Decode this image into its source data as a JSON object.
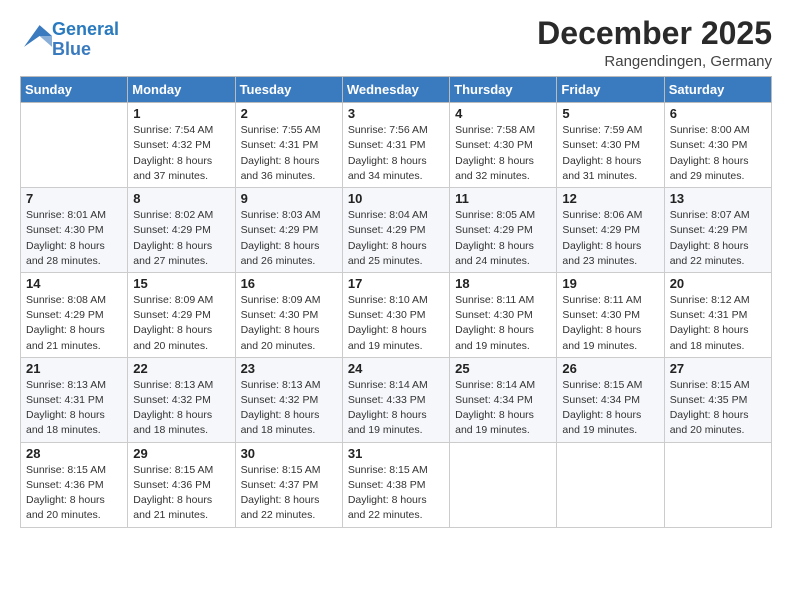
{
  "header": {
    "logo_line1": "General",
    "logo_line2": "Blue",
    "month": "December 2025",
    "location": "Rangendingen, Germany"
  },
  "weekdays": [
    "Sunday",
    "Monday",
    "Tuesday",
    "Wednesday",
    "Thursday",
    "Friday",
    "Saturday"
  ],
  "weeks": [
    [
      {
        "day": "",
        "info": ""
      },
      {
        "day": "1",
        "info": "Sunrise: 7:54 AM\nSunset: 4:32 PM\nDaylight: 8 hours\nand 37 minutes."
      },
      {
        "day": "2",
        "info": "Sunrise: 7:55 AM\nSunset: 4:31 PM\nDaylight: 8 hours\nand 36 minutes."
      },
      {
        "day": "3",
        "info": "Sunrise: 7:56 AM\nSunset: 4:31 PM\nDaylight: 8 hours\nand 34 minutes."
      },
      {
        "day": "4",
        "info": "Sunrise: 7:58 AM\nSunset: 4:30 PM\nDaylight: 8 hours\nand 32 minutes."
      },
      {
        "day": "5",
        "info": "Sunrise: 7:59 AM\nSunset: 4:30 PM\nDaylight: 8 hours\nand 31 minutes."
      },
      {
        "day": "6",
        "info": "Sunrise: 8:00 AM\nSunset: 4:30 PM\nDaylight: 8 hours\nand 29 minutes."
      }
    ],
    [
      {
        "day": "7",
        "info": "Sunrise: 8:01 AM\nSunset: 4:30 PM\nDaylight: 8 hours\nand 28 minutes."
      },
      {
        "day": "8",
        "info": "Sunrise: 8:02 AM\nSunset: 4:29 PM\nDaylight: 8 hours\nand 27 minutes."
      },
      {
        "day": "9",
        "info": "Sunrise: 8:03 AM\nSunset: 4:29 PM\nDaylight: 8 hours\nand 26 minutes."
      },
      {
        "day": "10",
        "info": "Sunrise: 8:04 AM\nSunset: 4:29 PM\nDaylight: 8 hours\nand 25 minutes."
      },
      {
        "day": "11",
        "info": "Sunrise: 8:05 AM\nSunset: 4:29 PM\nDaylight: 8 hours\nand 24 minutes."
      },
      {
        "day": "12",
        "info": "Sunrise: 8:06 AM\nSunset: 4:29 PM\nDaylight: 8 hours\nand 23 minutes."
      },
      {
        "day": "13",
        "info": "Sunrise: 8:07 AM\nSunset: 4:29 PM\nDaylight: 8 hours\nand 22 minutes."
      }
    ],
    [
      {
        "day": "14",
        "info": "Sunrise: 8:08 AM\nSunset: 4:29 PM\nDaylight: 8 hours\nand 21 minutes."
      },
      {
        "day": "15",
        "info": "Sunrise: 8:09 AM\nSunset: 4:29 PM\nDaylight: 8 hours\nand 20 minutes."
      },
      {
        "day": "16",
        "info": "Sunrise: 8:09 AM\nSunset: 4:30 PM\nDaylight: 8 hours\nand 20 minutes."
      },
      {
        "day": "17",
        "info": "Sunrise: 8:10 AM\nSunset: 4:30 PM\nDaylight: 8 hours\nand 19 minutes."
      },
      {
        "day": "18",
        "info": "Sunrise: 8:11 AM\nSunset: 4:30 PM\nDaylight: 8 hours\nand 19 minutes."
      },
      {
        "day": "19",
        "info": "Sunrise: 8:11 AM\nSunset: 4:30 PM\nDaylight: 8 hours\nand 19 minutes."
      },
      {
        "day": "20",
        "info": "Sunrise: 8:12 AM\nSunset: 4:31 PM\nDaylight: 8 hours\nand 18 minutes."
      }
    ],
    [
      {
        "day": "21",
        "info": "Sunrise: 8:13 AM\nSunset: 4:31 PM\nDaylight: 8 hours\nand 18 minutes."
      },
      {
        "day": "22",
        "info": "Sunrise: 8:13 AM\nSunset: 4:32 PM\nDaylight: 8 hours\nand 18 minutes."
      },
      {
        "day": "23",
        "info": "Sunrise: 8:13 AM\nSunset: 4:32 PM\nDaylight: 8 hours\nand 18 minutes."
      },
      {
        "day": "24",
        "info": "Sunrise: 8:14 AM\nSunset: 4:33 PM\nDaylight: 8 hours\nand 19 minutes."
      },
      {
        "day": "25",
        "info": "Sunrise: 8:14 AM\nSunset: 4:34 PM\nDaylight: 8 hours\nand 19 minutes."
      },
      {
        "day": "26",
        "info": "Sunrise: 8:15 AM\nSunset: 4:34 PM\nDaylight: 8 hours\nand 19 minutes."
      },
      {
        "day": "27",
        "info": "Sunrise: 8:15 AM\nSunset: 4:35 PM\nDaylight: 8 hours\nand 20 minutes."
      }
    ],
    [
      {
        "day": "28",
        "info": "Sunrise: 8:15 AM\nSunset: 4:36 PM\nDaylight: 8 hours\nand 20 minutes."
      },
      {
        "day": "29",
        "info": "Sunrise: 8:15 AM\nSunset: 4:36 PM\nDaylight: 8 hours\nand 21 minutes."
      },
      {
        "day": "30",
        "info": "Sunrise: 8:15 AM\nSunset: 4:37 PM\nDaylight: 8 hours\nand 22 minutes."
      },
      {
        "day": "31",
        "info": "Sunrise: 8:15 AM\nSunset: 4:38 PM\nDaylight: 8 hours\nand 22 minutes."
      },
      {
        "day": "",
        "info": ""
      },
      {
        "day": "",
        "info": ""
      },
      {
        "day": "",
        "info": ""
      }
    ]
  ]
}
